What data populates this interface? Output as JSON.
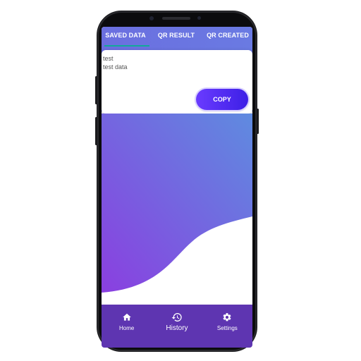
{
  "tabs": [
    {
      "label": "SAVED DATA"
    },
    {
      "label": "QR RESULT"
    },
    {
      "label": "QR CREATED"
    }
  ],
  "card": {
    "lines": [
      "test",
      "test data"
    ],
    "copy_label": "COPY"
  },
  "bottom_nav": [
    {
      "label": "Home",
      "icon": "home-icon"
    },
    {
      "label": "History",
      "icon": "history-icon"
    },
    {
      "label": "Settings",
      "icon": "gear-icon"
    }
  ],
  "colors": {
    "header": "#6a7ae2",
    "tab_indicator": "#12a899",
    "copy_button": "#5a2ff5",
    "bottom_nav": "#5e35b1",
    "wave_start": "#8a3fe0",
    "wave_end": "#5f8be0"
  }
}
